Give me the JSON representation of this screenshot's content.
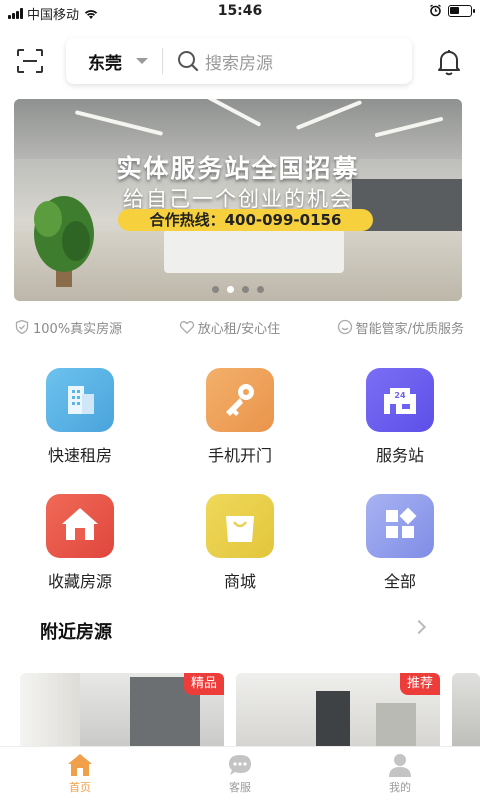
{
  "status_bar": {
    "carrier": "中国移动",
    "time": "15:46"
  },
  "header": {
    "city": "东莞",
    "search_placeholder": "搜索房源"
  },
  "banner": {
    "title": "实体服务站全国招募",
    "subtitle": "给自己一个创业的机会",
    "hotline": "合作热线：400-099-0156",
    "slide_count": 4,
    "active_slide": 2
  },
  "features": [
    "100%真实房源",
    "放心租/安心住",
    "智能管家/优质服务"
  ],
  "grid": [
    {
      "label": "快速租房",
      "icon": "building-icon",
      "color": "#5ab4e6"
    },
    {
      "label": "手机开门",
      "icon": "key-icon",
      "color": "#f0a35a"
    },
    {
      "label": "服务站",
      "icon": "store-24-icon",
      "color": "#6f61f0"
    },
    {
      "label": "收藏房源",
      "icon": "house-icon",
      "color": "#ec5d4f"
    },
    {
      "label": "商城",
      "icon": "shopping-bag-icon",
      "color": "#ead04f"
    },
    {
      "label": "全部",
      "icon": "grid-icon",
      "color": "#8f9ae8"
    }
  ],
  "nearby": {
    "title": "附近房源",
    "listings": [
      {
        "tag": "精品"
      },
      {
        "tag": "推荐"
      }
    ]
  },
  "tabs": [
    {
      "label": "首页",
      "icon": "home-icon",
      "active": true
    },
    {
      "label": "客服",
      "icon": "chat-icon",
      "active": false
    },
    {
      "label": "我的",
      "icon": "user-icon",
      "active": false
    }
  ],
  "accent_color": "#f0a04b"
}
